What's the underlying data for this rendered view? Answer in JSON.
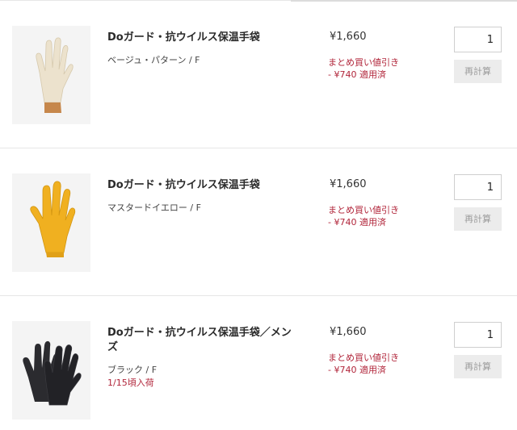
{
  "cart": {
    "items": [
      {
        "name": "Doガード・抗ウイルス保温手袋",
        "variant": "ベージュ・パターン / F",
        "stock_note": "",
        "price": "¥1,660",
        "discount_line1": "まとめ買い値引き",
        "discount_line2": "- ¥740 適用済",
        "quantity": "1",
        "recalc_label": "再計算",
        "image_icon": "beige-glove-image",
        "glove_color": "#ece2cd",
        "cuff_color": "#c6874b"
      },
      {
        "name": "Doガード・抗ウイルス保温手袋",
        "variant": "マスタードイエロー / F",
        "stock_note": "",
        "price": "¥1,660",
        "discount_line1": "まとめ買い値引き",
        "discount_line2": "- ¥740 適用済",
        "quantity": "1",
        "recalc_label": "再計算",
        "image_icon": "yellow-glove-image",
        "glove_color": "#f0b020",
        "cuff_color": "#e0a018"
      },
      {
        "name": "Doガード・抗ウイルス保温手袋／メンズ",
        "variant": "ブラック / F",
        "stock_note": "1/15頃入荷",
        "price": "¥1,660",
        "discount_line1": "まとめ買い値引き",
        "discount_line2": "- ¥740 適用済",
        "quantity": "1",
        "recalc_label": "再計算",
        "image_icon": "black-gloves-image",
        "glove_color": "#2b2b2f",
        "cuff_color": "#2b2b2f"
      }
    ],
    "colors": {
      "accent_red": "#b1253a",
      "divider": "#e6e6e6",
      "button_bg": "#ececec"
    }
  }
}
